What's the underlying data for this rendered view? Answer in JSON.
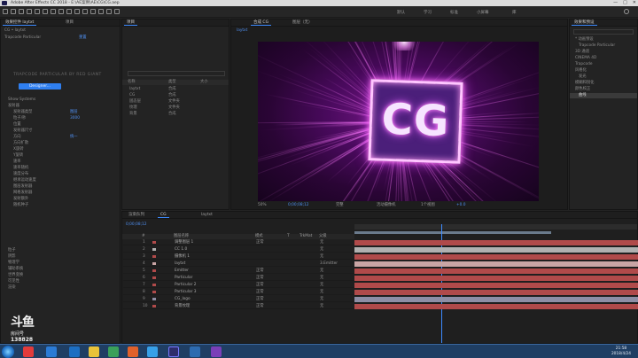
{
  "titlebar": {
    "title": "Adobe After Effects CC 2018 - E:\\AE案例\\AE\\CG\\CG.aep"
  },
  "window_controls": {
    "minimize": "—",
    "maximize": "□",
    "close": "✕"
  },
  "toolbar": {
    "workspace_labels": [
      "默认",
      "学习",
      "标准",
      "小屏幕",
      "库"
    ],
    "search_icon": "search-icon"
  },
  "left_panel": {
    "tabs": [
      "效果控件 laytxt",
      "项目"
    ],
    "top_text": "CG • laytxt",
    "effect_name": "Trapcode Particular",
    "effect_reset": "重置",
    "banner": "TRAPCODE PARTICULAR BY RED GIANT",
    "button": "Designer...",
    "rows": [
      {
        "label": "Show Systems",
        "value": ""
      },
      {
        "label": "发射器",
        "value": ""
      },
      {
        "label": "发射器类型",
        "value": "图层"
      },
      {
        "label": "粒子/秒",
        "value": "3000"
      },
      {
        "label": "位置",
        "value": ""
      },
      {
        "label": "发射器尺寸",
        "value": ""
      },
      {
        "label": "方向",
        "value": "统一"
      },
      {
        "label": "方向扩散",
        "value": ""
      },
      {
        "label": "X旋转",
        "value": ""
      },
      {
        "label": "Y旋转",
        "value": ""
      },
      {
        "label": "速率",
        "value": ""
      },
      {
        "label": "速率随机",
        "value": ""
      },
      {
        "label": "速度分布",
        "value": ""
      },
      {
        "label": "继承运动速度",
        "value": ""
      },
      {
        "label": "图层发射器",
        "value": ""
      },
      {
        "label": "网格发射器",
        "value": ""
      },
      {
        "label": "发射额外",
        "value": ""
      },
      {
        "label": "随机种子",
        "value": ""
      },
      {
        "label": "粒子",
        "value": ""
      },
      {
        "label": "阴影",
        "value": ""
      },
      {
        "label": "物理学",
        "value": ""
      },
      {
        "label": "辅助系统",
        "value": ""
      },
      {
        "label": "世界变换",
        "value": ""
      },
      {
        "label": "可见性",
        "value": ""
      },
      {
        "label": "渲染",
        "value": ""
      }
    ]
  },
  "project_panel": {
    "tabs": [
      "项目"
    ],
    "columns": [
      "名称",
      "类型",
      "大小"
    ],
    "items": [
      {
        "name": "laytxt",
        "type": "合成"
      },
      {
        "name": "CG",
        "type": "合成"
      },
      {
        "name": "固态层",
        "type": "文件夹"
      },
      {
        "name": "纹理",
        "type": "文件夹"
      },
      {
        "name": "背景",
        "type": "合成"
      }
    ]
  },
  "composition_panel": {
    "tabs": [
      "合成 CG",
      "图层（无）"
    ],
    "breadcrumb": "laytxt",
    "zoom": "50%",
    "resolution": "完整",
    "time": "0;00;08;12",
    "camera": "活动摄像机",
    "views": "1个视图",
    "offset": "+0.0",
    "cg_text": "CG"
  },
  "effects_panel": {
    "tabs": [
      "效果和预设"
    ],
    "tree": [
      "* 动画预设",
      "Trapcode Particular",
      "3D 通道",
      "CINEMA 4D",
      "Trapcode",
      "风格化",
      "发光",
      "模糊和锐化",
      "颜色校正",
      "曲线"
    ]
  },
  "timeline": {
    "tabs": [
      "渲染队列",
      "CG",
      "laytxt"
    ],
    "timecode": "0;00;08;12",
    "columns": [
      "#",
      "图层名称",
      "父级",
      "模式",
      "T",
      "TrkMat"
    ],
    "layers": [
      {
        "num": "1",
        "name": "调整图层 1",
        "mode": "正常",
        "parent": "无",
        "color": "#b04a4a"
      },
      {
        "num": "2",
        "name": "CC 1.0",
        "mode": "",
        "parent": "无",
        "color": "#b0b0b0"
      },
      {
        "num": "3",
        "name": "摄像机 1",
        "mode": "",
        "parent": "无",
        "color": "#b04a4a"
      },
      {
        "num": "4",
        "name": "laytxt",
        "mode": "",
        "parent": "3.Emitter",
        "color": "#c9a5a5"
      },
      {
        "num": "5",
        "name": "Emitter",
        "mode": "正常",
        "parent": "无",
        "color": "#b04a4a"
      },
      {
        "num": "6",
        "name": "Particular",
        "mode": "正常",
        "parent": "无",
        "color": "#b04a4a"
      },
      {
        "num": "7",
        "name": "Particular 2",
        "mode": "正常",
        "parent": "无",
        "color": "#b04a4a"
      },
      {
        "num": "8",
        "name": "Particular 3",
        "mode": "正常",
        "parent": "无",
        "color": "#b04a4a"
      },
      {
        "num": "9",
        "name": "CG_logo",
        "mode": "正常",
        "parent": "无",
        "color": "#8e8ea5"
      },
      {
        "num": "10",
        "name": "背景纹理",
        "mode": "正常",
        "parent": "无",
        "color": "#b04a4a"
      }
    ]
  },
  "watermark": {
    "line1": "斗鱼",
    "line2": "房间号",
    "room": "138828"
  },
  "taskbar": {
    "time": "21:58",
    "date": "2018/4/24"
  }
}
